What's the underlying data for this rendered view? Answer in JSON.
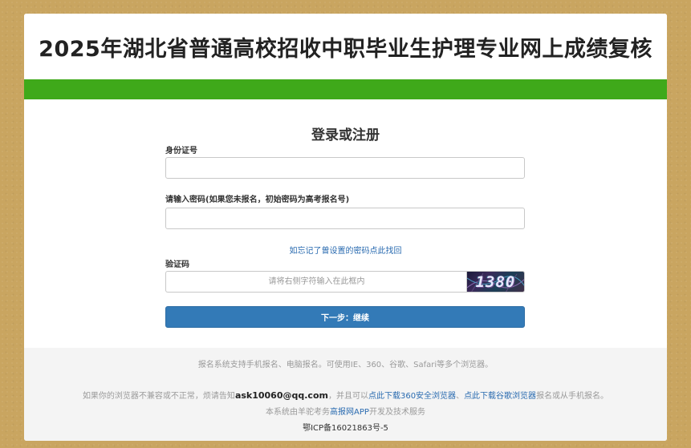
{
  "header": {
    "title": "2025年湖北省普通高校招收中职毕业生护理专业网上成绩复核"
  },
  "colors": {
    "accent_bar": "#3fa91a",
    "primary_button": "#337ab7",
    "link": "#2a6bb0"
  },
  "form": {
    "title": "登录或注册",
    "id_label": "身份证号",
    "id_value": "",
    "password_label": "请输入密码(如果您未报名，初始密码为高考报名号)",
    "password_value": "",
    "forgot_link": "如忘记了曾设置的密码点此找回",
    "captcha_label": "验证码",
    "captcha_placeholder": "请将右侧字符输入在此框内",
    "captcha_image_text": "1380",
    "submit_label": "下一步：继续"
  },
  "footer": {
    "line1": "报名系统支持手机报名、电脑报名。可使用IE、360、谷歌、Safari等多个浏览器。",
    "line2_prefix": "如果你的浏览器不兼容或不正常，烦请告知",
    "line2_email": "ask10060@qq.com",
    "line2_mid": "，并且可以",
    "line2_link1": "点此下载360安全浏览器",
    "line2_sep": "、",
    "line2_link2": "点此下载谷歌浏览器",
    "line2_suffix": "报名或从手机报名。",
    "line3_prefix": "本系统由羊驼考务",
    "line3_link": "高报网APP",
    "line3_suffix": "开发及技术服务",
    "icp": "鄂ICP备16021863号-5"
  }
}
